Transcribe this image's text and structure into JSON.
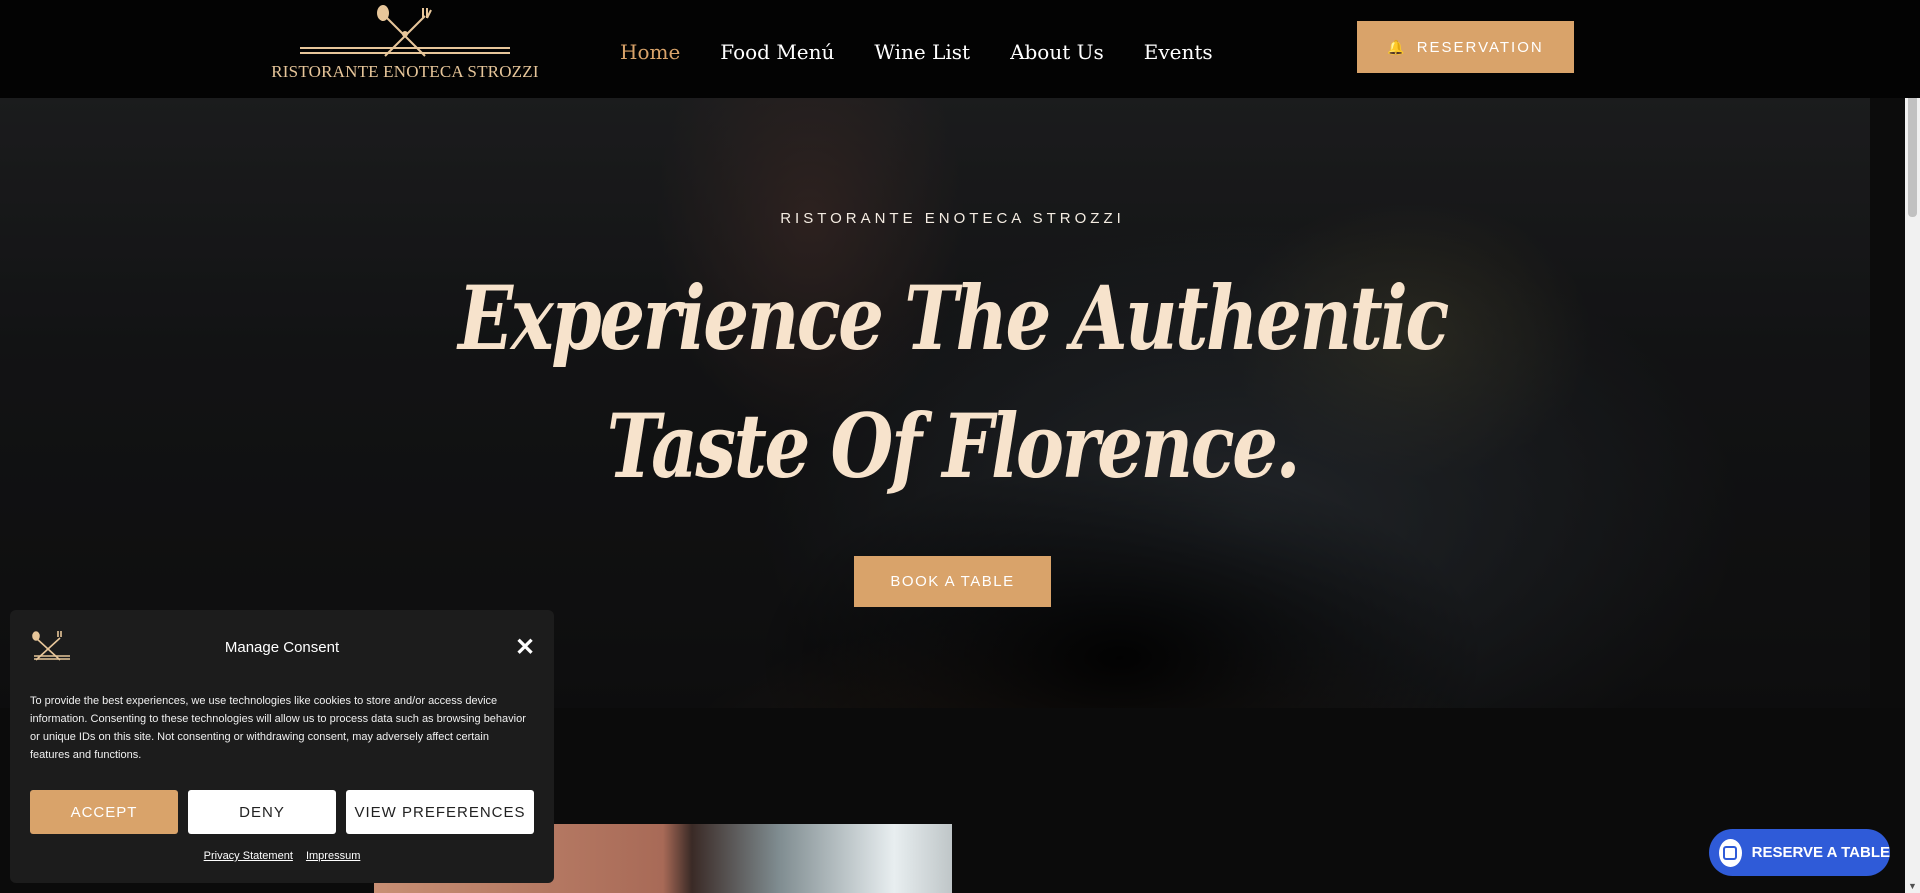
{
  "header": {
    "logo_text": "RISTORANTE ENOTECA STROZZI",
    "nav": [
      {
        "label": "Home",
        "active": true
      },
      {
        "label": "Food Menú"
      },
      {
        "label": "Wine List"
      },
      {
        "label": "About Us"
      },
      {
        "label": "Events"
      }
    ],
    "reservation_label": "RESERVATION",
    "reservation_icon": "bell-icon"
  },
  "hero": {
    "subtitle": "RISTORANTE ENOTECA STROZZI",
    "line1": "Experience The Authentic",
    "line2_regular": "Taste Of",
    "line2_bold": "Florence.",
    "book_label": "BOOK A TABLE"
  },
  "consent": {
    "title": "Manage Consent",
    "text": "To provide the best experiences, we use technologies like cookies to store and/or access device information. Consenting to these technologies will allow us to process data such as browsing behavior or unique IDs on this site. Not consenting or withdrawing consent, may adversely affect certain features and functions.",
    "accept_label": "ACCEPT",
    "deny_label": "DENY",
    "prefs_label": "VIEW PREFERENCES",
    "privacy_link": "Privacy Statement",
    "impressum_link": "Impressum"
  },
  "float_reserve": {
    "label": "RESERVE A TABLE",
    "icon": "calendar-icon"
  },
  "colors": {
    "accent": "#d9a36a",
    "hero_text": "#f7e3cc",
    "float_button": "#2f5bd8",
    "header_bg": "#030303"
  }
}
